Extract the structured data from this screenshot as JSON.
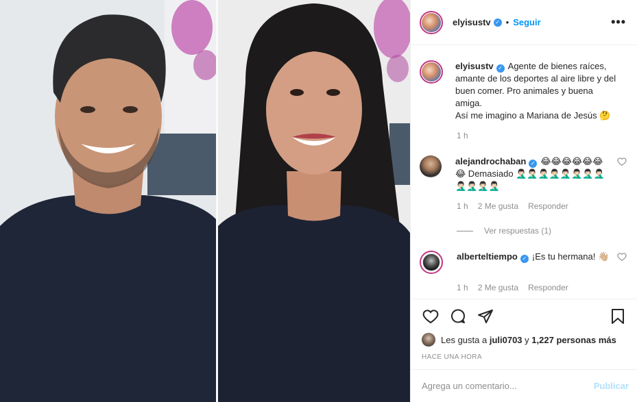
{
  "header": {
    "username": "elyisustv",
    "dot": "•",
    "follow_label": "Seguir",
    "more_label": "•••"
  },
  "caption": {
    "username": "elyisustv",
    "line1": "Agente de bienes raíces, amante de los deportes al aire libre y del buen comer. Pro animales y buena amiga.",
    "line2": "Así me imagino a Mariana de Jesús 🤔",
    "time": "1 h"
  },
  "comments": [
    {
      "username": "alejandrochaban",
      "text": "😂😂😂😂😂😂😂 Demasiado 🤦🏻‍♂️🤦🏻‍♂️🤦🏻‍♂️🤦🏻‍♂️🤦🏻‍♂️🤦🏻‍♂️🤦🏻‍♂️🤦🏻‍♂️🤦🏻‍♂️🤦🏻‍♂️🤦🏻‍♂️🤦🏻‍♂️",
      "time": "1 h",
      "likes": "2 Me gusta",
      "reply": "Responder",
      "view_replies": "Ver respuestas (1)"
    },
    {
      "username": "alberteltiempo",
      "text": "¡Es tu hermana! 👋🏼",
      "time": "1 h",
      "likes": "2 Me gusta",
      "reply": "Responder"
    }
  ],
  "likes": {
    "prefix": "Les gusta a",
    "user": "juli0703",
    "middle": "y",
    "count": "1,227 personas más"
  },
  "timestamp": "Hace una hora",
  "add_comment": {
    "placeholder": "Agrega un comentario...",
    "publish_label": "Publicar"
  },
  "colors": {
    "accent": "#0095f6",
    "verified": "#3897f0",
    "muted": "#8e8e8e",
    "border": "#efefef",
    "publish_disabled": "#b2dffc"
  }
}
